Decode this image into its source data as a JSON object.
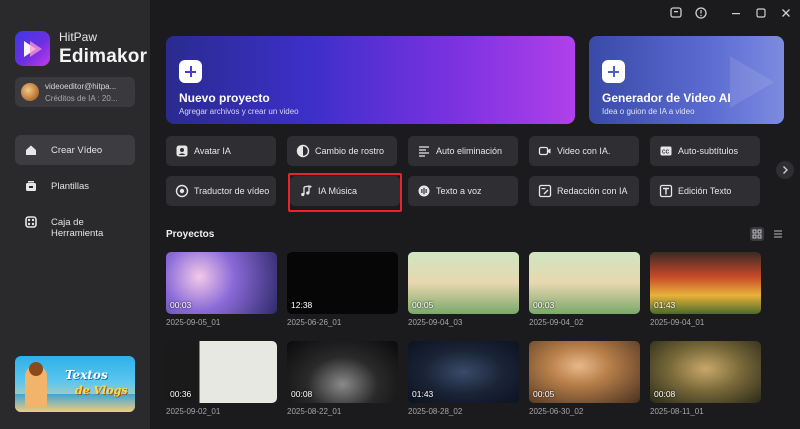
{
  "app": {
    "brand_top": "HitPaw",
    "brand_main": "Edimakor",
    "accent": "#6b2fe0"
  },
  "titlebar": {
    "icons": [
      "feedback-icon",
      "help-icon",
      "minimize-icon",
      "maximize-icon",
      "close-icon"
    ]
  },
  "account": {
    "email": "videoeditor@hitpa...",
    "credits": "Créditos de IA : 20..."
  },
  "sidebar": {
    "items": [
      {
        "label": "Crear Vídeo",
        "icon": "home-icon",
        "active": true
      },
      {
        "label": "Plantillas",
        "icon": "templates-icon",
        "active": false
      },
      {
        "label": "Caja de Herramienta",
        "icon": "toolbox-icon",
        "active": false
      }
    ],
    "promo": {
      "line1": "Textos",
      "line2": "de Vlogs"
    }
  },
  "hero": {
    "new_project": {
      "title": "Nuevo proyecto",
      "subtitle": "Agregar archivos y crear un video"
    },
    "ai_video": {
      "title": "Generador de Video AI",
      "subtitle": "Idea o guion de IA a video"
    }
  },
  "tools": [
    {
      "label": "Avatar IA",
      "icon": "avatar-icon"
    },
    {
      "label": "Cambio de rostro",
      "icon": "face-swap-icon"
    },
    {
      "label": "Auto eliminación",
      "icon": "auto-remove-icon"
    },
    {
      "label": "Video con IA.",
      "icon": "ai-video-icon"
    },
    {
      "label": "Auto-subtítulos",
      "icon": "subtitles-icon"
    },
    {
      "label": "Traductor de vídeo",
      "icon": "translate-icon"
    },
    {
      "label": "IA Música",
      "icon": "music-icon"
    },
    {
      "label": "Texto a voz",
      "icon": "text-to-speech-icon"
    },
    {
      "label": "Redacción con IA",
      "icon": "ai-writing-icon"
    },
    {
      "label": "Edición Texto",
      "icon": "text-edit-icon"
    }
  ],
  "projects": {
    "title": "Proyectos",
    "items": [
      {
        "name": "2025-09-05_01",
        "duration": "00:03"
      },
      {
        "name": "2025-06-26_01",
        "duration": "12:38"
      },
      {
        "name": "2025-09-04_03",
        "duration": "00:05"
      },
      {
        "name": "2025-09-04_02",
        "duration": "00:03"
      },
      {
        "name": "2025-09-04_01",
        "duration": "01:43"
      },
      {
        "name": "2025-09-02_01",
        "duration": "00:36"
      },
      {
        "name": "2025-08-22_01",
        "duration": "00:08"
      },
      {
        "name": "2025-08-28_02",
        "duration": "01:43"
      },
      {
        "name": "2025-06-30_02",
        "duration": "00:05"
      },
      {
        "name": "2025-08-11_01",
        "duration": "00:08"
      }
    ]
  }
}
